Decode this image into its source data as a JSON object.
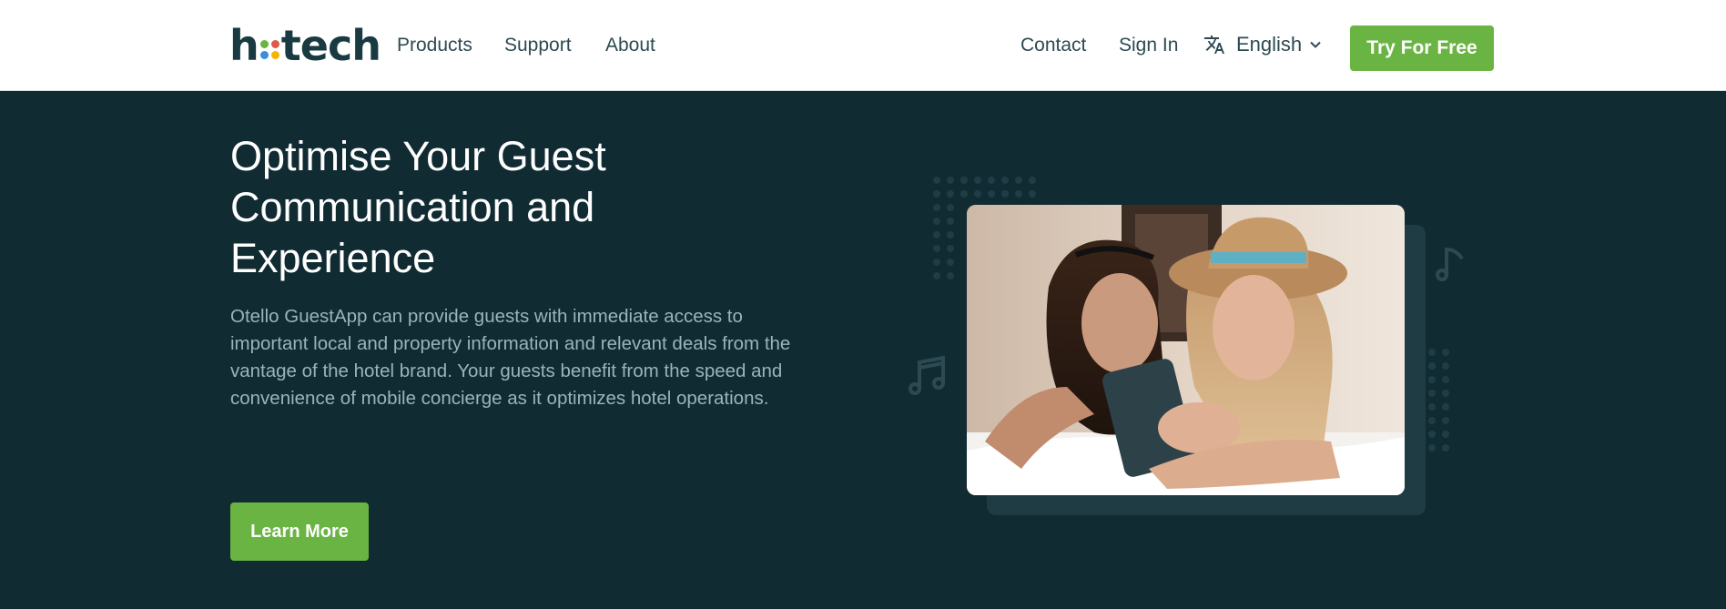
{
  "header": {
    "logo": {
      "prefix": "h",
      "suffix": "tech",
      "dot_colors": [
        "#6ab443",
        "#e2574c",
        "#3b8fd6",
        "#f4b400"
      ]
    },
    "nav": {
      "products": "Products",
      "support": "Support",
      "about": "About"
    },
    "contact": "Contact",
    "sign_in": "Sign In",
    "language": {
      "selected": "English",
      "icon": "translate-icon"
    },
    "try_free": "Try For Free"
  },
  "hero": {
    "title": "Optimise Your Guest Communication and Experience",
    "description": "Otello GuestApp can provide guests with immediate access to important local and property information and relevant deals from the vantage of the hotel brand. Your guests benefit from the speed and convenience of mobile concierge as it optimizes hotel operations.",
    "cta": "Learn More",
    "image": "two-women-looking-at-phone-photo"
  },
  "colors": {
    "accent": "#6ab443",
    "background": "#112b33",
    "header_bg": "#ffffff",
    "text_muted": "#9bb4bb"
  }
}
